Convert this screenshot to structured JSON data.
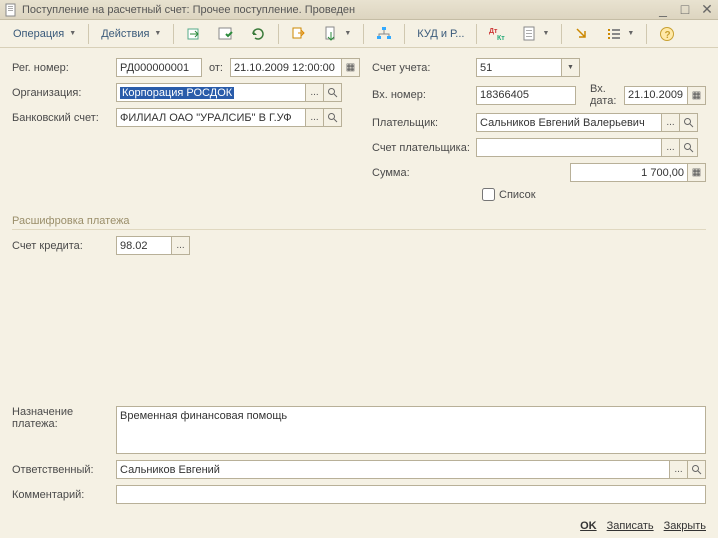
{
  "titlebar": {
    "text": "Поступление на расчетный счет: Прочее поступление. Проведен"
  },
  "toolbar": {
    "operation": "Операция",
    "actions": "Действия",
    "kudir": "КУД и Р..."
  },
  "fields": {
    "reg_num_lbl": "Рег. номер:",
    "reg_num": "РД000000001",
    "ot_lbl": "от:",
    "date": "21.10.2009 12:00:00",
    "org_lbl": "Организация:",
    "org": "Корпорация РОСДОК",
    "bank_lbl": "Банковский счет:",
    "bank": "ФИЛИАЛ ОАО \"УРАЛСИБ\" В Г.УФ",
    "acct_lbl": "Счет учета:",
    "acct": "51",
    "vxnum_lbl": "Вх. номер:",
    "vxnum": "18366405",
    "vxdate_lbl": "Вх. дата:",
    "vxdate": "21.10.2009",
    "payer_lbl": "Плательщик:",
    "payer": "Сальников Евгений Валерьевич",
    "payer_acct_lbl": "Счет плательщика:",
    "payer_acct": "",
    "sum_lbl": "Сумма:",
    "sum": "1 700,00",
    "section": "Расшифровка платежа",
    "list_lbl": "Список",
    "credit_lbl": "Счет кредита:",
    "credit": "98.02",
    "purpose_lbl1": "Назначение",
    "purpose_lbl2": "платежа:",
    "purpose": "Временная финансовая помощь",
    "resp_lbl": "Ответственный:",
    "resp": "Сальников Евгений",
    "comment_lbl": "Комментарий:",
    "comment": ""
  },
  "footer": {
    "ok": "OK",
    "save": "Записать",
    "close": "Закрыть"
  }
}
